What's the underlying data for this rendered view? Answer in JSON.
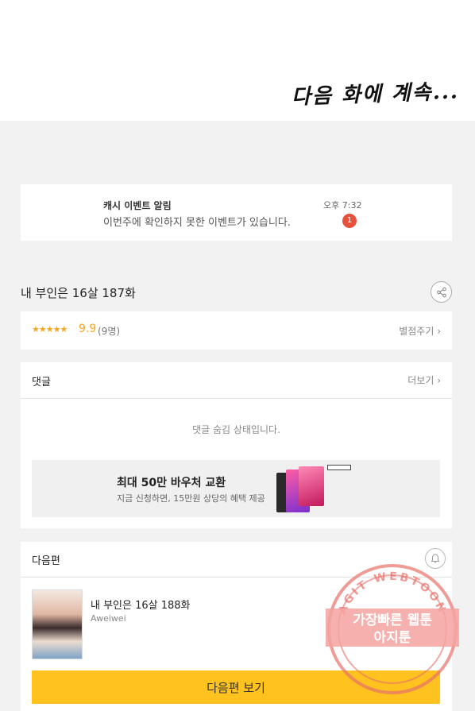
{
  "top": {
    "handwriting": "다음 화에 계속..."
  },
  "notification": {
    "title": "캐시 이벤트 알림",
    "body": "이번주에 확인하지 못한 이벤트가 있습니다.",
    "time": "오후 7:32",
    "badge": "1"
  },
  "episode": {
    "title": "내 부인은 16살 187화",
    "share_icon": "share-icon"
  },
  "rating": {
    "stars": "★★★★★",
    "score": "9.9",
    "count": "(9명)",
    "rate_label": "별점주기 ›"
  },
  "comments": {
    "header": "댓글",
    "more": "더보기 ›",
    "hidden_text": "댓글 숨김 상태입니다.",
    "promo_title": "최대 50만 바우처 교환",
    "promo_subtitle": "지금 신청하면, 15만원 상당의 혜택 제공"
  },
  "next": {
    "header": "다음편",
    "bell_icon": "bell-icon",
    "episode_title": "내 부인은 16살 188화",
    "author": "Aweiwei",
    "button_label": "다음편 보기"
  },
  "watermark": {
    "arc_text": "AGIT WEBTOON",
    "line1": "가장빠른 웹툰",
    "line2": "아지툰"
  },
  "colors": {
    "accent": "#ffc21e",
    "badge": "#e8513b",
    "star": "#f5a623",
    "watermark": "#e8706a"
  }
}
